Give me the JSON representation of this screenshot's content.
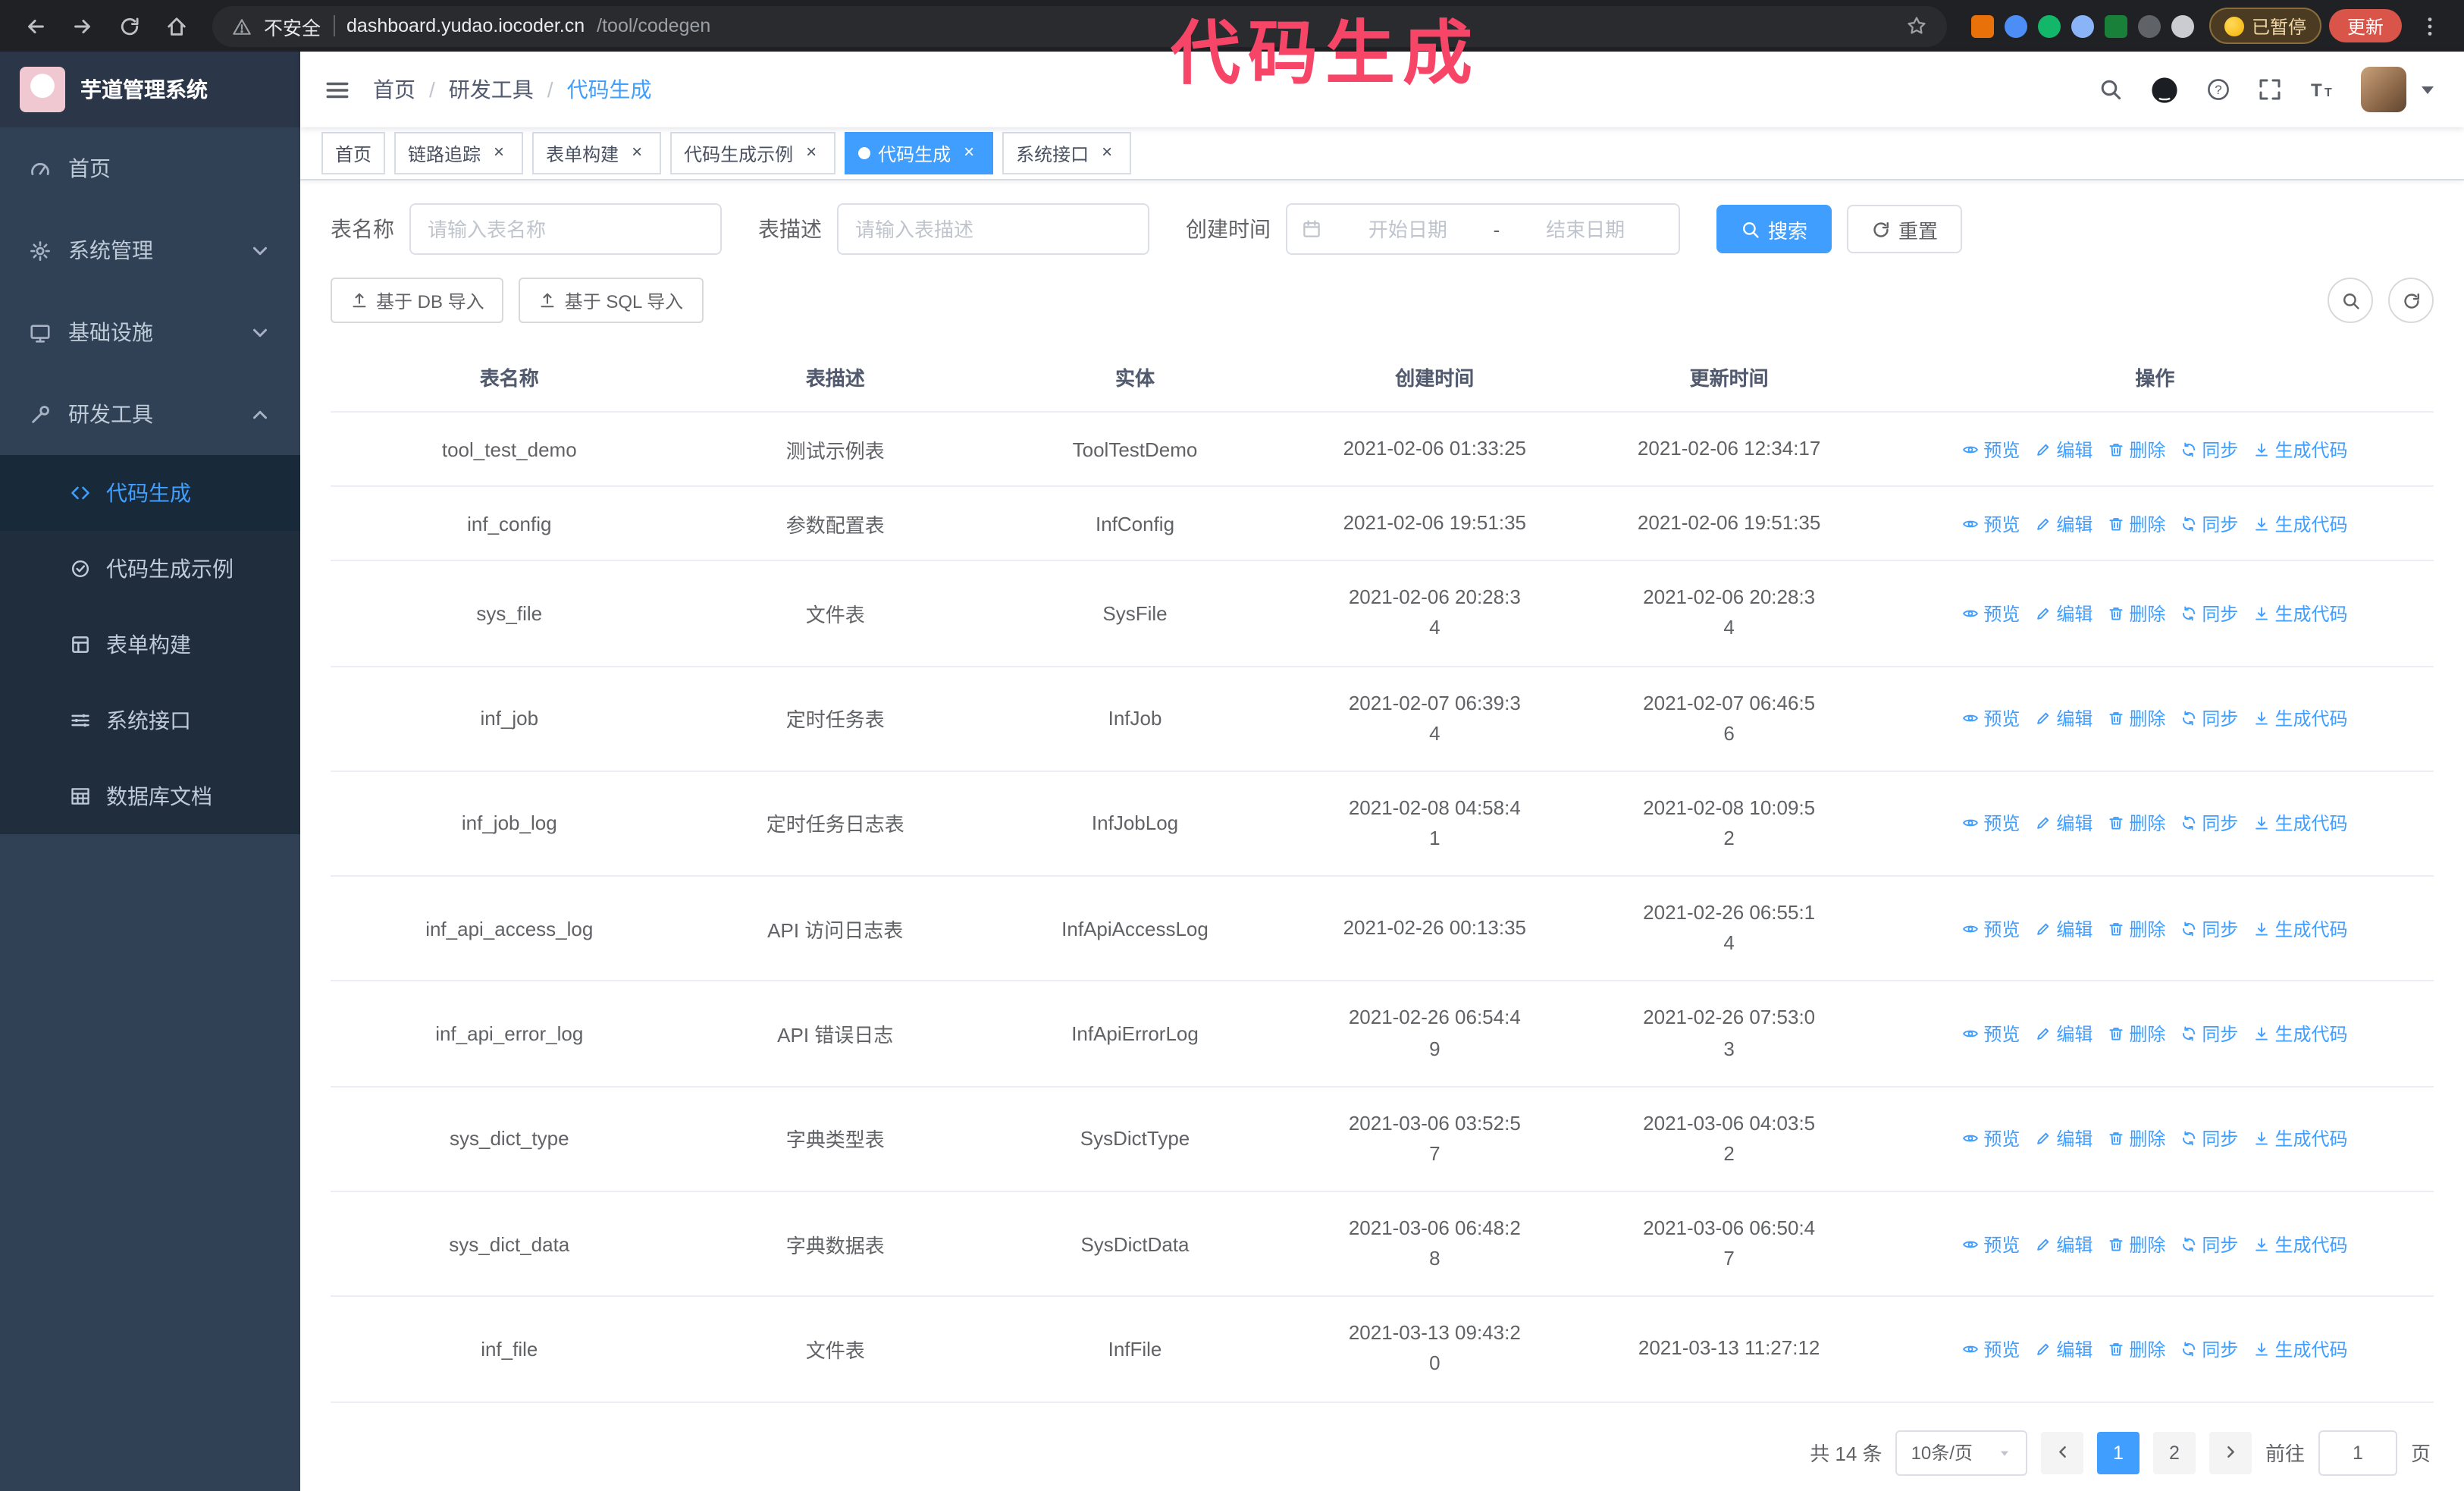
{
  "colors": {
    "accent": "#409eff",
    "annotation_pink": "#f74568",
    "sidebar_bg": "#304156",
    "submenu_bg": "#1f2d3d"
  },
  "annotation": {
    "text": "代码生成"
  },
  "browser": {
    "security_label": "不安全",
    "url_host": "dashboard.yudao.iocoder.cn",
    "url_path": "/tool/codegen",
    "paused_badge": "已暂停",
    "update_button": "更新"
  },
  "sidebar": {
    "logo_title": "芋道管理系统",
    "items": [
      {
        "label": "首页",
        "icon": "dashboard-icon"
      },
      {
        "label": "系统管理",
        "icon": "gear-icon",
        "chevron": "down"
      },
      {
        "label": "基础设施",
        "icon": "infra-icon",
        "chevron": "down"
      },
      {
        "label": "研发工具",
        "icon": "tool-icon",
        "chevron": "up",
        "expanded": true
      }
    ],
    "subitems": [
      {
        "label": "代码生成",
        "icon": "code-icon",
        "active": true
      },
      {
        "label": "代码生成示例",
        "icon": "example-icon"
      },
      {
        "label": "表单构建",
        "icon": "form-icon"
      },
      {
        "label": "系统接口",
        "icon": "api-icon"
      },
      {
        "label": "数据库文档",
        "icon": "dbdoc-icon"
      }
    ]
  },
  "navbar": {
    "breadcrumb": [
      "首页",
      "研发工具",
      "代码生成"
    ],
    "separator": "/"
  },
  "tabs": [
    {
      "label": "首页",
      "closable": false,
      "active": false
    },
    {
      "label": "链路追踪",
      "closable": true,
      "active": false
    },
    {
      "label": "表单构建",
      "closable": true,
      "active": false
    },
    {
      "label": "代码生成示例",
      "closable": true,
      "active": false
    },
    {
      "label": "代码生成",
      "closable": true,
      "active": true
    },
    {
      "label": "系统接口",
      "closable": true,
      "active": false
    }
  ],
  "filters": {
    "name_label": "表名称",
    "name_placeholder": "请输入表名称",
    "desc_label": "表描述",
    "desc_placeholder": "请输入表描述",
    "time_label": "创建时间",
    "start_placeholder": "开始日期",
    "end_placeholder": "结束日期",
    "range_separator": "-",
    "search_button": "搜索",
    "reset_button": "重置"
  },
  "toolbar": {
    "import_db_button": "基于 DB 导入",
    "import_sql_button": "基于 SQL 导入"
  },
  "table": {
    "headers": [
      "表名称",
      "表描述",
      "实体",
      "创建时间",
      "更新时间",
      "操作"
    ],
    "actions": [
      {
        "label": "预览",
        "icon": "eye-icon"
      },
      {
        "label": "编辑",
        "icon": "edit-icon"
      },
      {
        "label": "删除",
        "icon": "delete-icon"
      },
      {
        "label": "同步",
        "icon": "sync-icon"
      },
      {
        "label": "生成代码",
        "icon": "download-icon"
      }
    ],
    "rows": [
      {
        "name": "tool_test_demo",
        "desc": "测试示例表",
        "entity": "ToolTestDemo",
        "created": "2021-02-06 01:33:25",
        "updated": "2021-02-06 12:34:17"
      },
      {
        "name": "inf_config",
        "desc": "参数配置表",
        "entity": "InfConfig",
        "created": "2021-02-06 19:51:35",
        "updated": "2021-02-06 19:51:35"
      },
      {
        "name": "sys_file",
        "desc": "文件表",
        "entity": "SysFile",
        "created": "2021-02-06 20:28:3\n4",
        "updated": "2021-02-06 20:28:3\n4"
      },
      {
        "name": "inf_job",
        "desc": "定时任务表",
        "entity": "InfJob",
        "created": "2021-02-07 06:39:3\n4",
        "updated": "2021-02-07 06:46:5\n6"
      },
      {
        "name": "inf_job_log",
        "desc": "定时任务日志表",
        "entity": "InfJobLog",
        "created": "2021-02-08 04:58:4\n1",
        "updated": "2021-02-08 10:09:5\n2"
      },
      {
        "name": "inf_api_access_log",
        "desc": "API 访问日志表",
        "entity": "InfApiAccessLog",
        "created": "2021-02-26 00:13:35",
        "updated": "2021-02-26 06:55:1\n4"
      },
      {
        "name": "inf_api_error_log",
        "desc": "API 错误日志",
        "entity": "InfApiErrorLog",
        "created": "2021-02-26 06:54:4\n9",
        "updated": "2021-02-26 07:53:0\n3"
      },
      {
        "name": "sys_dict_type",
        "desc": "字典类型表",
        "entity": "SysDictType",
        "created": "2021-03-06 03:52:5\n7",
        "updated": "2021-03-06 04:03:5\n2"
      },
      {
        "name": "sys_dict_data",
        "desc": "字典数据表",
        "entity": "SysDictData",
        "created": "2021-03-06 06:48:2\n8",
        "updated": "2021-03-06 06:50:4\n7"
      },
      {
        "name": "inf_file",
        "desc": "文件表",
        "entity": "InfFile",
        "created": "2021-03-13 09:43:2\n0",
        "updated": "2021-03-13 11:27:12"
      }
    ]
  },
  "pagination": {
    "total_text": "共 14 条",
    "page_size": "10条/页",
    "pages": [
      "1",
      "2"
    ],
    "active_page": "1",
    "goto_label": "前往",
    "goto_value": "1",
    "goto_suffix": "页"
  }
}
